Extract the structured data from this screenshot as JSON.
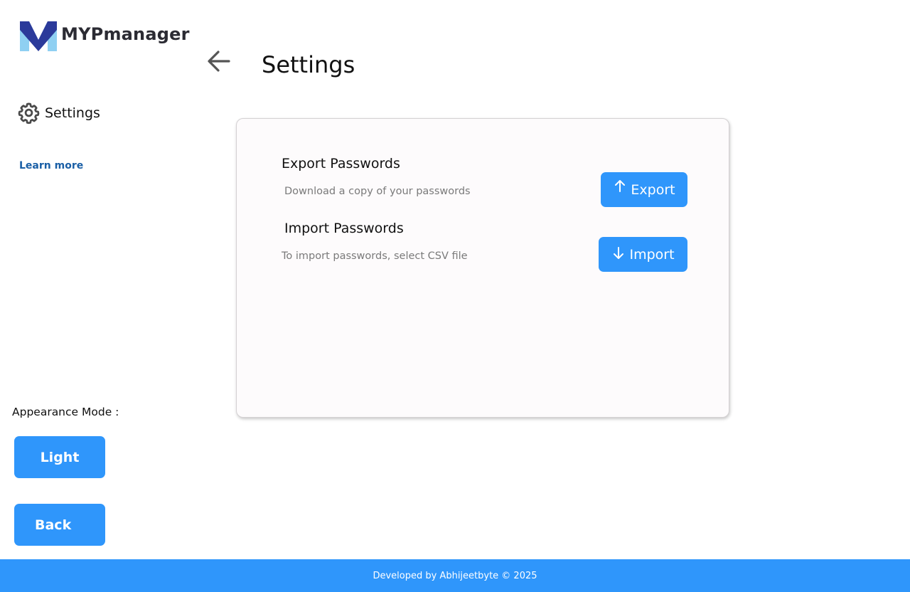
{
  "brand": {
    "name": "MYPmanager",
    "colors": {
      "mark_dark": "#2b3a9a",
      "mark_light": "#8fd0f2",
      "text": "#2b2b33"
    },
    "icon": "logo-icon"
  },
  "sidebar": {
    "settings_item": {
      "label": "Settings",
      "icon": "gear-icon"
    },
    "learn_more": "Learn more",
    "appearance_label": "Appearance Mode :",
    "light_button": "Light",
    "back_button": "Back"
  },
  "header": {
    "back_icon": "arrow-left-icon",
    "title": "Settings"
  },
  "card": {
    "export": {
      "title": "Export Passwords",
      "description": "Download a copy of your passwords",
      "button_label": "Export",
      "button_icon": "arrow-up-icon"
    },
    "import": {
      "title": "Import Passwords",
      "description": "To import passwords, select CSV file",
      "button_label": "Import",
      "button_icon": "arrow-down-icon"
    }
  },
  "footer": {
    "text": "Developed by Abhijeetbyte © 2025"
  },
  "theme": {
    "accent": "#2f96fb",
    "link": "#1a5fa6",
    "muted_text": "#7a7a7a",
    "card_bg": "#fdfbfc"
  }
}
